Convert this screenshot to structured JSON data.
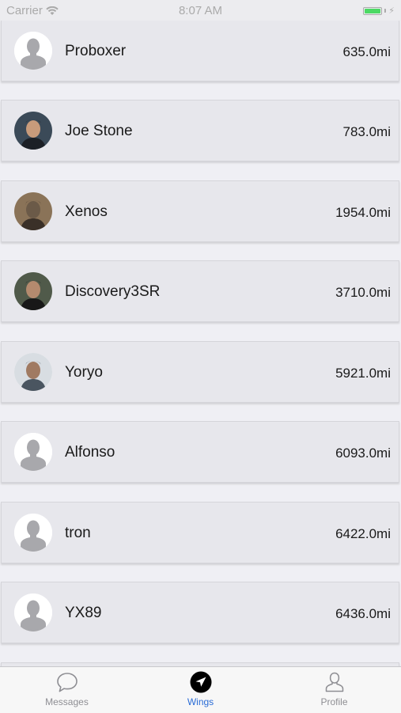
{
  "status_bar": {
    "carrier": "Carrier",
    "time": "8:07 AM",
    "battery_level": 1.0,
    "battery_color": "#4cd964"
  },
  "list": {
    "items": [
      {
        "name": "Proboxer",
        "distance": "635.0mi",
        "avatar": "placeholder-avatar"
      },
      {
        "name": "Joe Stone",
        "distance": "783.0mi",
        "avatar": "photo-avatar"
      },
      {
        "name": "Xenos",
        "distance": "1954.0mi",
        "avatar": "photo-avatar"
      },
      {
        "name": "Discovery3SR",
        "distance": "3710.0mi",
        "avatar": "photo-avatar"
      },
      {
        "name": "Yoryo",
        "distance": "5921.0mi",
        "avatar": "photo-avatar"
      },
      {
        "name": "Alfonso",
        "distance": "6093.0mi",
        "avatar": "placeholder-avatar"
      },
      {
        "name": "tron",
        "distance": "6422.0mi",
        "avatar": "placeholder-avatar"
      },
      {
        "name": "YX89",
        "distance": "6436.0mi",
        "avatar": "placeholder-avatar"
      }
    ]
  },
  "tab_bar": {
    "tabs": [
      {
        "label": "Messages",
        "icon": "speech-bubble-icon",
        "active": false
      },
      {
        "label": "Wings",
        "icon": "navigation-arrow-icon",
        "active": true
      },
      {
        "label": "Profile",
        "icon": "person-icon",
        "active": false
      }
    ],
    "active_color": "#2a6cd6"
  }
}
